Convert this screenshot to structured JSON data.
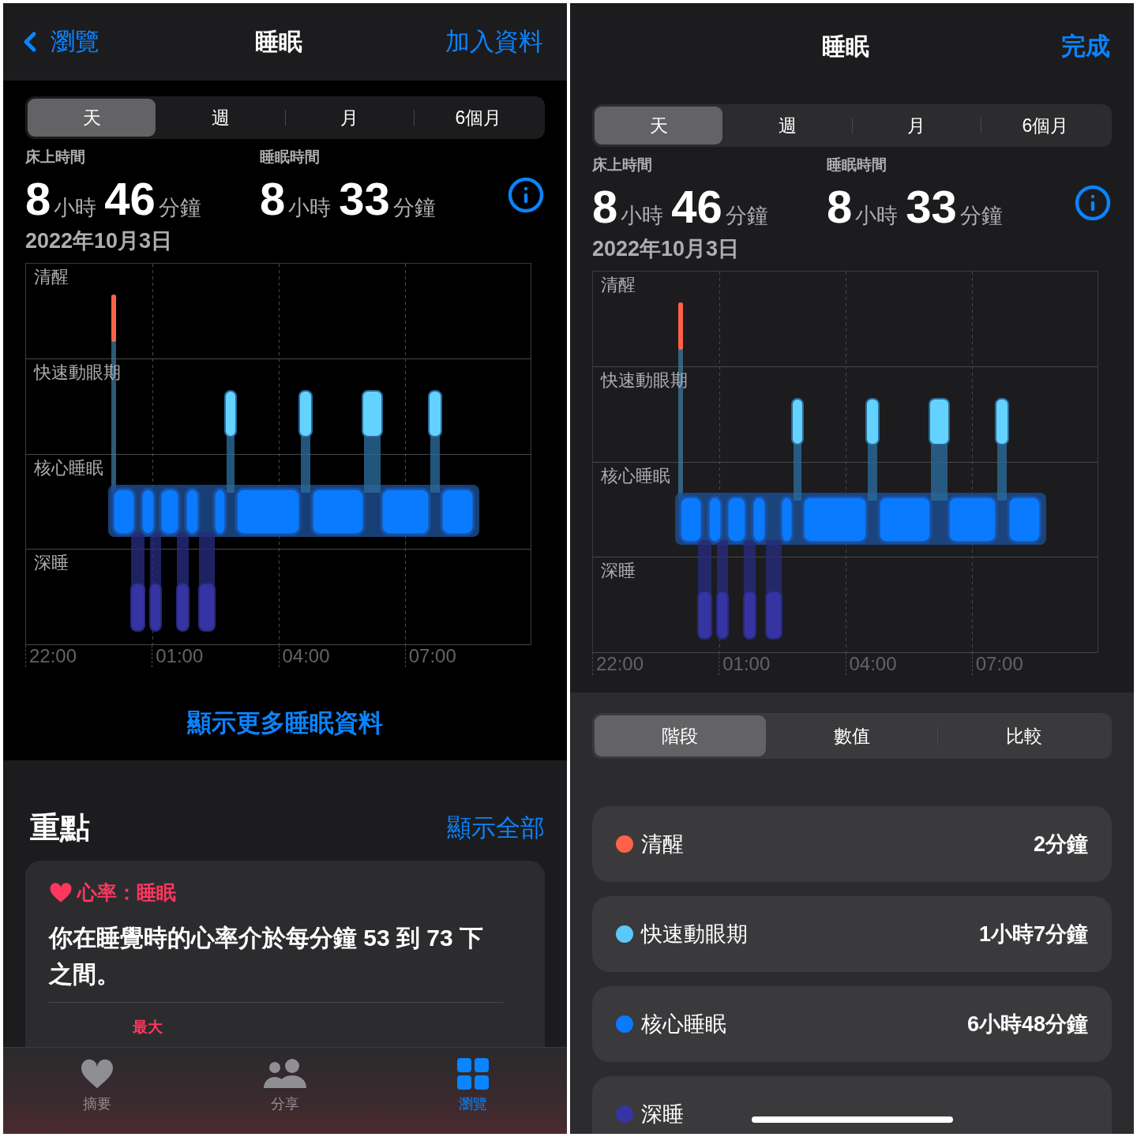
{
  "left": {
    "nav": {
      "back": "瀏覽",
      "title": "睡眠",
      "action": "加入資料"
    },
    "range_tabs": [
      {
        "label": "天",
        "selected": true
      },
      {
        "label": "週",
        "selected": false
      },
      {
        "label": "月",
        "selected": false
      },
      {
        "label": "6個月",
        "selected": false
      }
    ],
    "stats": [
      {
        "label": "床上時間",
        "hours": "8",
        "hour_unit": "小時",
        "minutes": "46",
        "minute_unit": "分鐘"
      },
      {
        "label": "睡眠時間",
        "hours": "8",
        "hour_unit": "小時",
        "minutes": "33",
        "minute_unit": "分鐘"
      }
    ],
    "date": "2022年10月3日",
    "chart": {
      "stages": [
        "清醒",
        "快速動眼期",
        "核心睡眠",
        "深睡"
      ],
      "times": [
        "22:00",
        "01:00",
        "04:00",
        "07:00"
      ]
    },
    "more_link": "顯示更多睡眠資料",
    "highlights": {
      "title": "重點",
      "show_all": "顯示全部",
      "card": {
        "title": "心率：睡眠",
        "text": "你在睡覺時的心率介於每分鐘 53 到 73 下之間。",
        "footer_label": "最大"
      }
    },
    "tab_bar": [
      {
        "kind": "heart",
        "label": "摘要",
        "selected": false
      },
      {
        "kind": "people",
        "label": "分享",
        "selected": false
      },
      {
        "kind": "grid",
        "label": "瀏覽",
        "selected": true
      }
    ]
  },
  "right": {
    "nav": {
      "title": "睡眠",
      "done": "完成"
    },
    "range_tabs": [
      {
        "label": "天",
        "selected": true
      },
      {
        "label": "週",
        "selected": false
      },
      {
        "label": "月",
        "selected": false
      },
      {
        "label": "6個月",
        "selected": false
      }
    ],
    "stats": [
      {
        "label": "床上時間",
        "hours": "8",
        "hour_unit": "小時",
        "minutes": "46",
        "minute_unit": "分鐘"
      },
      {
        "label": "睡眠時間",
        "hours": "8",
        "hour_unit": "小時",
        "minutes": "33",
        "minute_unit": "分鐘"
      }
    ],
    "date": "2022年10月3日",
    "chart": {
      "stages": [
        "清醒",
        "快速動眼期",
        "核心睡眠",
        "深睡"
      ],
      "times": [
        "22:00",
        "01:00",
        "04:00",
        "07:00"
      ]
    },
    "view_tabs": [
      {
        "label": "階段",
        "selected": true
      },
      {
        "label": "數值",
        "selected": false
      },
      {
        "label": "比較",
        "selected": false
      }
    ],
    "stages": [
      {
        "name": "清醒",
        "value": "2分鐘",
        "color": "#ff6347"
      },
      {
        "name": "快速動眼期",
        "value": "1小時7分鐘",
        "color": "#5ac8fa"
      },
      {
        "name": "核心睡眠",
        "value": "6小時48分鐘",
        "color": "#0a7aff"
      },
      {
        "name": "深睡",
        "color": "#3634a3"
      }
    ]
  }
}
